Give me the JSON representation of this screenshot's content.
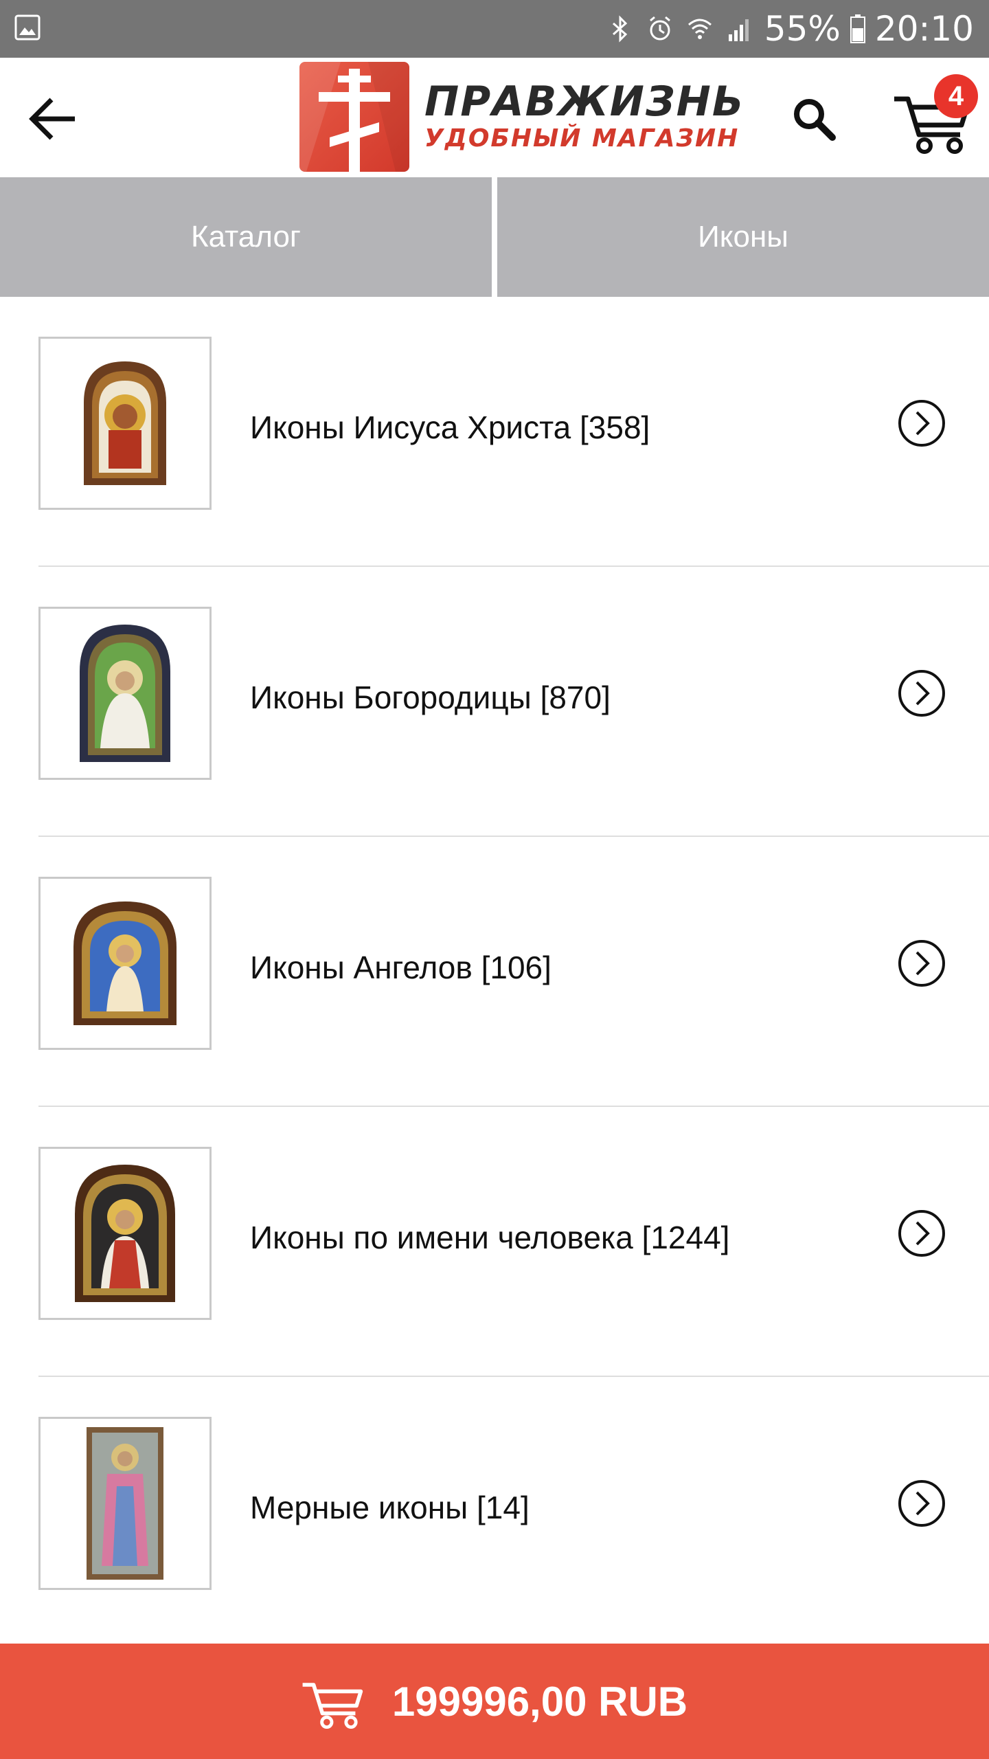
{
  "status_bar": {
    "battery_percent": "55%",
    "time": "20:10",
    "icons": [
      "gallery-notification-icon",
      "bluetooth-icon",
      "alarm-icon",
      "wifi-icon",
      "signal-icon",
      "battery-icon"
    ]
  },
  "header": {
    "logo_title": "ПРАВЖИЗНЬ",
    "logo_subtitle": "УДОБНЫЙ МАГАЗИН",
    "cart_count": "4",
    "icons": [
      "back-arrow-icon",
      "search-icon",
      "cart-icon"
    ],
    "accent": "#d23a2c"
  },
  "breadcrumb": {
    "items": [
      {
        "label": "Каталог"
      },
      {
        "label": "Иконы"
      }
    ]
  },
  "categories": [
    {
      "label": "Иконы Иисуса Христа [358]",
      "thumb": "icon-christ"
    },
    {
      "label": "Иконы Богородицы [870]",
      "thumb": "icon-theotokos"
    },
    {
      "label": "Иконы Ангелов [106]",
      "thumb": "icon-angel"
    },
    {
      "label": "Иконы по имени человека [1244]",
      "thumb": "icon-saint"
    },
    {
      "label": "Мерные иконы [14]",
      "thumb": "icon-measured"
    }
  ],
  "cart_total": {
    "amount": "199996,00 RUB",
    "background": "#e9543f"
  }
}
